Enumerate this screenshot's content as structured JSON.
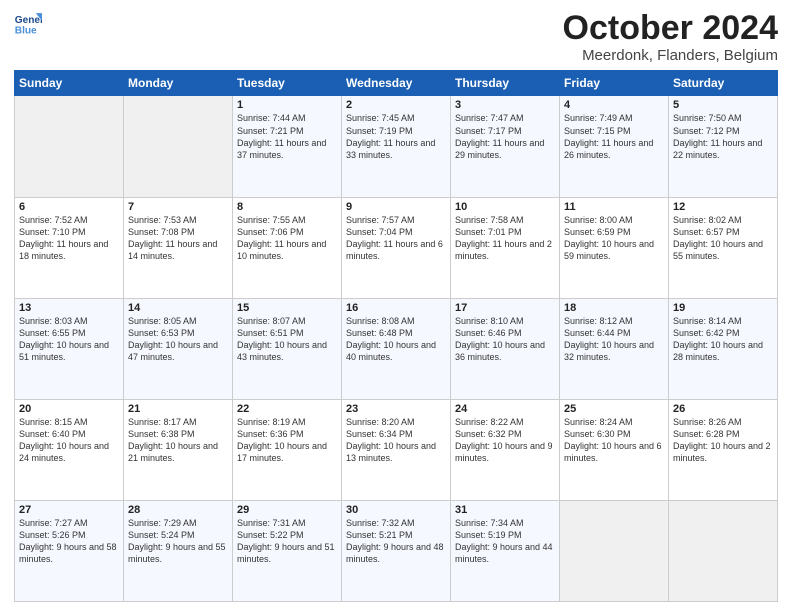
{
  "logo": {
    "line1": "General",
    "line2": "Blue"
  },
  "title": "October 2024",
  "location": "Meerdonk, Flanders, Belgium",
  "days_header": [
    "Sunday",
    "Monday",
    "Tuesday",
    "Wednesday",
    "Thursday",
    "Friday",
    "Saturday"
  ],
  "weeks": [
    [
      {
        "num": "",
        "info": ""
      },
      {
        "num": "",
        "info": ""
      },
      {
        "num": "1",
        "info": "Sunrise: 7:44 AM\nSunset: 7:21 PM\nDaylight: 11 hours\nand 37 minutes."
      },
      {
        "num": "2",
        "info": "Sunrise: 7:45 AM\nSunset: 7:19 PM\nDaylight: 11 hours\nand 33 minutes."
      },
      {
        "num": "3",
        "info": "Sunrise: 7:47 AM\nSunset: 7:17 PM\nDaylight: 11 hours\nand 29 minutes."
      },
      {
        "num": "4",
        "info": "Sunrise: 7:49 AM\nSunset: 7:15 PM\nDaylight: 11 hours\nand 26 minutes."
      },
      {
        "num": "5",
        "info": "Sunrise: 7:50 AM\nSunset: 7:12 PM\nDaylight: 11 hours\nand 22 minutes."
      }
    ],
    [
      {
        "num": "6",
        "info": "Sunrise: 7:52 AM\nSunset: 7:10 PM\nDaylight: 11 hours\nand 18 minutes."
      },
      {
        "num": "7",
        "info": "Sunrise: 7:53 AM\nSunset: 7:08 PM\nDaylight: 11 hours\nand 14 minutes."
      },
      {
        "num": "8",
        "info": "Sunrise: 7:55 AM\nSunset: 7:06 PM\nDaylight: 11 hours\nand 10 minutes."
      },
      {
        "num": "9",
        "info": "Sunrise: 7:57 AM\nSunset: 7:04 PM\nDaylight: 11 hours\nand 6 minutes."
      },
      {
        "num": "10",
        "info": "Sunrise: 7:58 AM\nSunset: 7:01 PM\nDaylight: 11 hours\nand 2 minutes."
      },
      {
        "num": "11",
        "info": "Sunrise: 8:00 AM\nSunset: 6:59 PM\nDaylight: 10 hours\nand 59 minutes."
      },
      {
        "num": "12",
        "info": "Sunrise: 8:02 AM\nSunset: 6:57 PM\nDaylight: 10 hours\nand 55 minutes."
      }
    ],
    [
      {
        "num": "13",
        "info": "Sunrise: 8:03 AM\nSunset: 6:55 PM\nDaylight: 10 hours\nand 51 minutes."
      },
      {
        "num": "14",
        "info": "Sunrise: 8:05 AM\nSunset: 6:53 PM\nDaylight: 10 hours\nand 47 minutes."
      },
      {
        "num": "15",
        "info": "Sunrise: 8:07 AM\nSunset: 6:51 PM\nDaylight: 10 hours\nand 43 minutes."
      },
      {
        "num": "16",
        "info": "Sunrise: 8:08 AM\nSunset: 6:48 PM\nDaylight: 10 hours\nand 40 minutes."
      },
      {
        "num": "17",
        "info": "Sunrise: 8:10 AM\nSunset: 6:46 PM\nDaylight: 10 hours\nand 36 minutes."
      },
      {
        "num": "18",
        "info": "Sunrise: 8:12 AM\nSunset: 6:44 PM\nDaylight: 10 hours\nand 32 minutes."
      },
      {
        "num": "19",
        "info": "Sunrise: 8:14 AM\nSunset: 6:42 PM\nDaylight: 10 hours\nand 28 minutes."
      }
    ],
    [
      {
        "num": "20",
        "info": "Sunrise: 8:15 AM\nSunset: 6:40 PM\nDaylight: 10 hours\nand 24 minutes."
      },
      {
        "num": "21",
        "info": "Sunrise: 8:17 AM\nSunset: 6:38 PM\nDaylight: 10 hours\nand 21 minutes."
      },
      {
        "num": "22",
        "info": "Sunrise: 8:19 AM\nSunset: 6:36 PM\nDaylight: 10 hours\nand 17 minutes."
      },
      {
        "num": "23",
        "info": "Sunrise: 8:20 AM\nSunset: 6:34 PM\nDaylight: 10 hours\nand 13 minutes."
      },
      {
        "num": "24",
        "info": "Sunrise: 8:22 AM\nSunset: 6:32 PM\nDaylight: 10 hours\nand 9 minutes."
      },
      {
        "num": "25",
        "info": "Sunrise: 8:24 AM\nSunset: 6:30 PM\nDaylight: 10 hours\nand 6 minutes."
      },
      {
        "num": "26",
        "info": "Sunrise: 8:26 AM\nSunset: 6:28 PM\nDaylight: 10 hours\nand 2 minutes."
      }
    ],
    [
      {
        "num": "27",
        "info": "Sunrise: 7:27 AM\nSunset: 5:26 PM\nDaylight: 9 hours\nand 58 minutes."
      },
      {
        "num": "28",
        "info": "Sunrise: 7:29 AM\nSunset: 5:24 PM\nDaylight: 9 hours\nand 55 minutes."
      },
      {
        "num": "29",
        "info": "Sunrise: 7:31 AM\nSunset: 5:22 PM\nDaylight: 9 hours\nand 51 minutes."
      },
      {
        "num": "30",
        "info": "Sunrise: 7:32 AM\nSunset: 5:21 PM\nDaylight: 9 hours\nand 48 minutes."
      },
      {
        "num": "31",
        "info": "Sunrise: 7:34 AM\nSunset: 5:19 PM\nDaylight: 9 hours\nand 44 minutes."
      },
      {
        "num": "",
        "info": ""
      },
      {
        "num": "",
        "info": ""
      }
    ]
  ]
}
